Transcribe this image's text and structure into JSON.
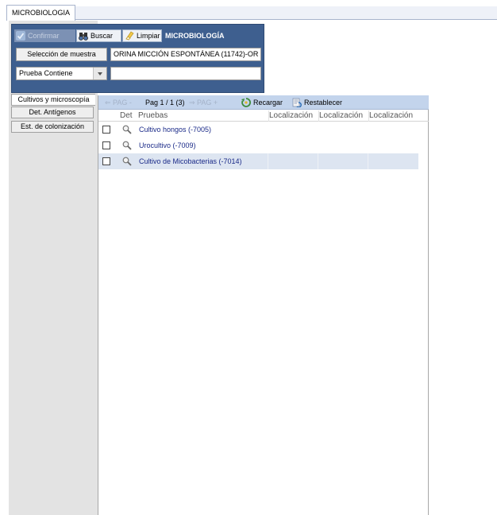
{
  "top_tab": {
    "label": "MICROBIOLOGIA"
  },
  "header": {
    "confirm_label": "Confirmar",
    "search_label": "Buscar",
    "clear_label": "Limpiar",
    "title": "MICROBIOLOGÍA",
    "sample_button_label": "Selección de muestra",
    "sample_value": "ORINA MICCIÓN ESPONTÁNEA (11742)-OR",
    "filter_select_value": "Prueba Contiene",
    "filter_input_value": ""
  },
  "side_tabs": [
    {
      "label": "Cultivos y microscopía"
    },
    {
      "label": "Det. Antígenos"
    },
    {
      "label": "Est. de colonización"
    }
  ],
  "grid": {
    "toolbar": {
      "prev_label": "⇐ PAG -",
      "page_info": "Pag 1 / 1 (3)",
      "next_label": "⇒ PAG +",
      "reload_label": "Recargar",
      "reset_label": "Restablecer"
    },
    "columns": [
      "Det",
      "Pruebas",
      "Localización",
      "Localización",
      "Localización"
    ],
    "rows": [
      {
        "name": "Cultivo hongos (-7005)",
        "checked": false,
        "selected": false
      },
      {
        "name": "Urocultivo (-7009)",
        "checked": false,
        "selected": false
      },
      {
        "name": "Cultivo de Micobacterias (-7014)",
        "checked": false,
        "selected": true
      }
    ]
  },
  "colors": {
    "header_panel": "#3e5f8f",
    "grid_toolbar": "#c3d4ec",
    "row_selected": "#dde5f1",
    "row_text": "#1a2a88"
  },
  "icons": [
    "check-icon",
    "binoculars-icon",
    "eraser-icon",
    "reload-icon",
    "reset-icon",
    "magnifier-icon"
  ]
}
